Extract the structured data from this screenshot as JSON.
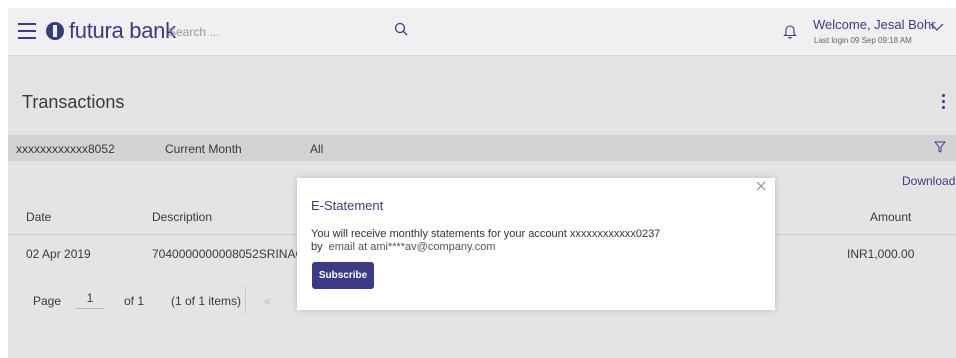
{
  "header": {
    "brand": "futura bank",
    "search_placeholder": "Search ...",
    "welcome": "Welcome, Jesal Bohr",
    "last_login": "Last login 09 Sep 09:18 AM"
  },
  "page": {
    "title": "Transactions"
  },
  "filters": {
    "account": "xxxxxxxxxxxx8052",
    "period": "Current Month",
    "type": "All"
  },
  "download_label": "Download",
  "table": {
    "headers": {
      "date": "Date",
      "description": "Description",
      "amount": "Amount"
    },
    "rows": [
      {
        "date": "02 Apr 2019",
        "description": "7040000000008052SRINAG",
        "amount": "INR1,000.00"
      }
    ]
  },
  "pagination": {
    "page_label": "Page",
    "current_page": "1",
    "of_label": "of 1",
    "items_label": "(1 of 1 items)"
  },
  "modal": {
    "title": "E-Statement",
    "message_line1": "You will receive monthly statements for your account xxxxxxxxxxxx0237",
    "message_by": "by",
    "message_email": "email at ami****av@company.com",
    "subscribe_label": "Subscribe"
  },
  "colors": {
    "brand": "#3b3a86",
    "overlay": "#e4e4e4",
    "filter_bar": "#d3d3d3"
  },
  "icons": [
    "menu-icon",
    "logo-icon",
    "search-icon",
    "bell-icon",
    "chevron-down-icon",
    "kebab-menu-icon",
    "filter-icon",
    "first-page-icon",
    "close-icon"
  ]
}
